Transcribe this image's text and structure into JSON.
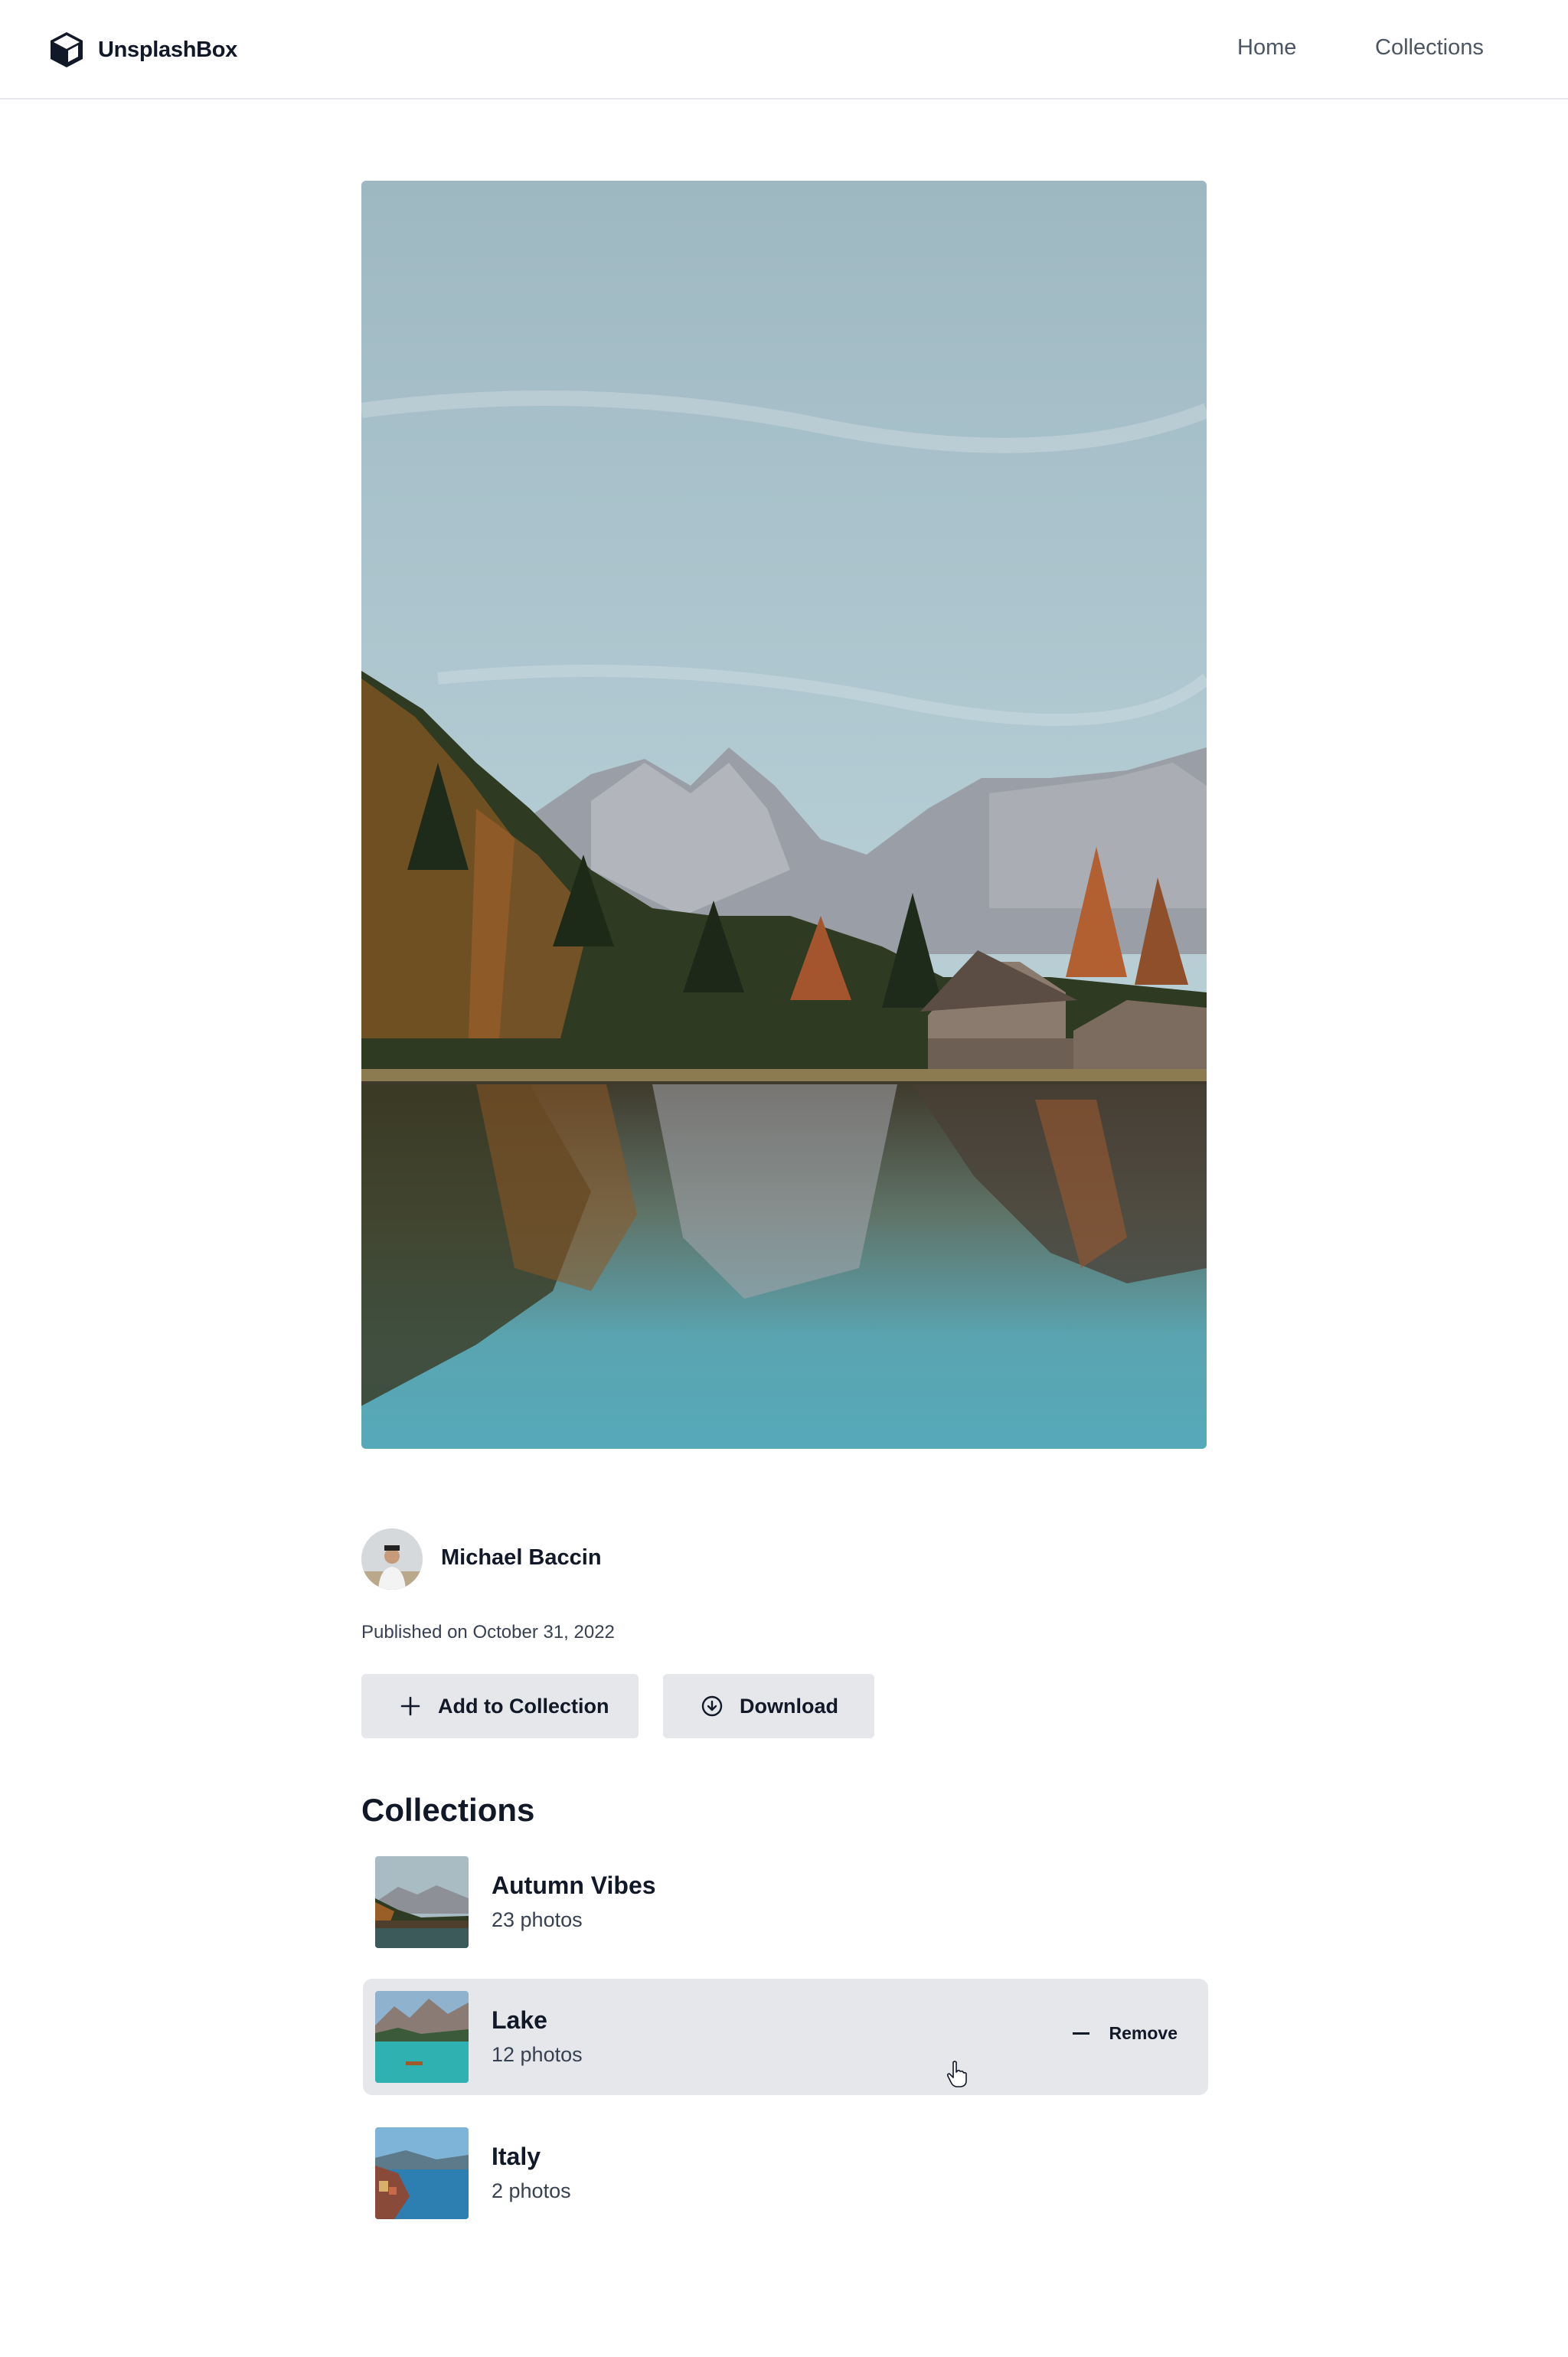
{
  "header": {
    "brand": "UnsplashBox",
    "nav": {
      "home": "Home",
      "collections": "Collections"
    }
  },
  "photo": {
    "author": "Michael Baccin",
    "published": "Published on October 31, 2022"
  },
  "actions": {
    "add_to_collection": "Add to Collection",
    "download": "Download"
  },
  "collections": {
    "title": "Collections",
    "remove_label": "Remove",
    "items": [
      {
        "name": "Autumn Vibes",
        "count": "23 photos"
      },
      {
        "name": "Lake",
        "count": "12 photos"
      },
      {
        "name": "Italy",
        "count": "2 photos"
      }
    ]
  },
  "icons": {
    "logo": "cube-icon",
    "add": "plus-icon",
    "download": "download-circle-icon",
    "remove": "minus-icon",
    "cursor": "pointer-hand-icon"
  }
}
